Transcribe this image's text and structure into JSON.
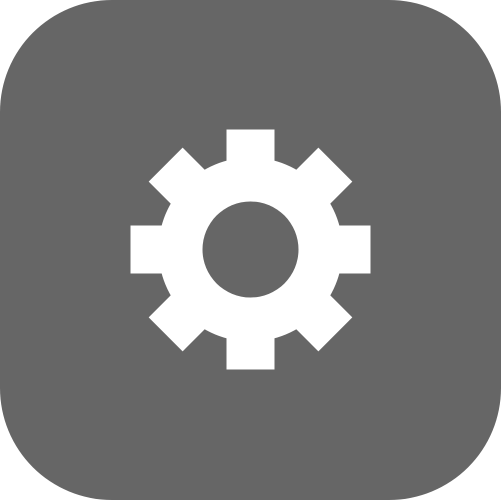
{
  "icon": {
    "name": "settings-icon",
    "background_color": "#666666",
    "glyph_color": "#ffffff"
  }
}
